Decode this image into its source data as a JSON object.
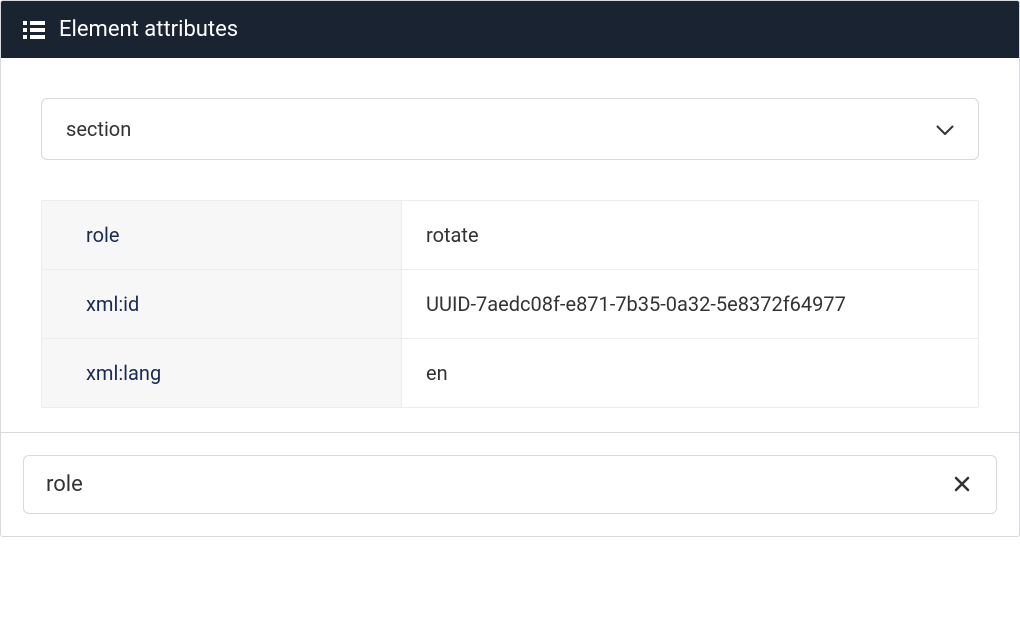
{
  "header": {
    "title": "Element attributes",
    "icon": "list-icon"
  },
  "dropdown": {
    "selected": "section"
  },
  "attributes": [
    {
      "name": "role",
      "value": "rotate"
    },
    {
      "name": "xml:id",
      "value": "UUID-7aedc08f-e871-7b35-0a32-5e8372f64977"
    },
    {
      "name": "xml:lang",
      "value": "en"
    }
  ],
  "filter": {
    "value": "role"
  }
}
